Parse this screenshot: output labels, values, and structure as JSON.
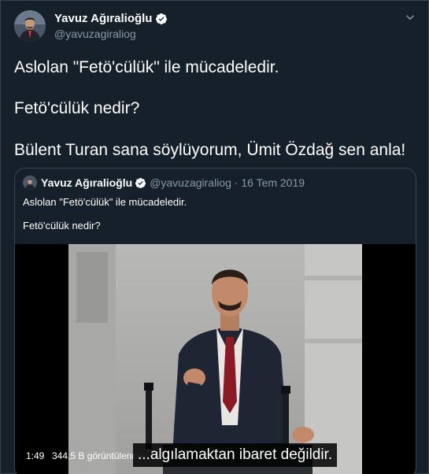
{
  "tweet": {
    "author_name": "Yavuz Ağıralioğlu",
    "handle": "@yavuzagiraliog",
    "lines": [
      "Aslolan \"Fetö'cülük\" ile mücadeledir.",
      "Fetö'cülük nedir?",
      "Bülent Turan sana söylüyorum, Ümit Özdağ sen anla!"
    ],
    "verified_icon": "verified-badge-icon",
    "menu_icon": "chevron-down-icon"
  },
  "quoted_tweet": {
    "author_name": "Yavuz Ağıralioğlu",
    "handle_date": "@yavuzagiraliog · 16 Tem 2019",
    "lines": [
      "Aslolan \"Fetö'cülük\" ile mücadeledir.",
      "Fetö'cülük nedir?"
    ]
  },
  "video": {
    "duration": "1:49",
    "views": "344,5 B görüntülenme",
    "subtitle": "...algılamaktan ibaret değildir."
  },
  "colors": {
    "background": "#15202b",
    "border": "#38444d",
    "secondary_text": "#8899a6",
    "verified_blue": "#1da1f2"
  }
}
